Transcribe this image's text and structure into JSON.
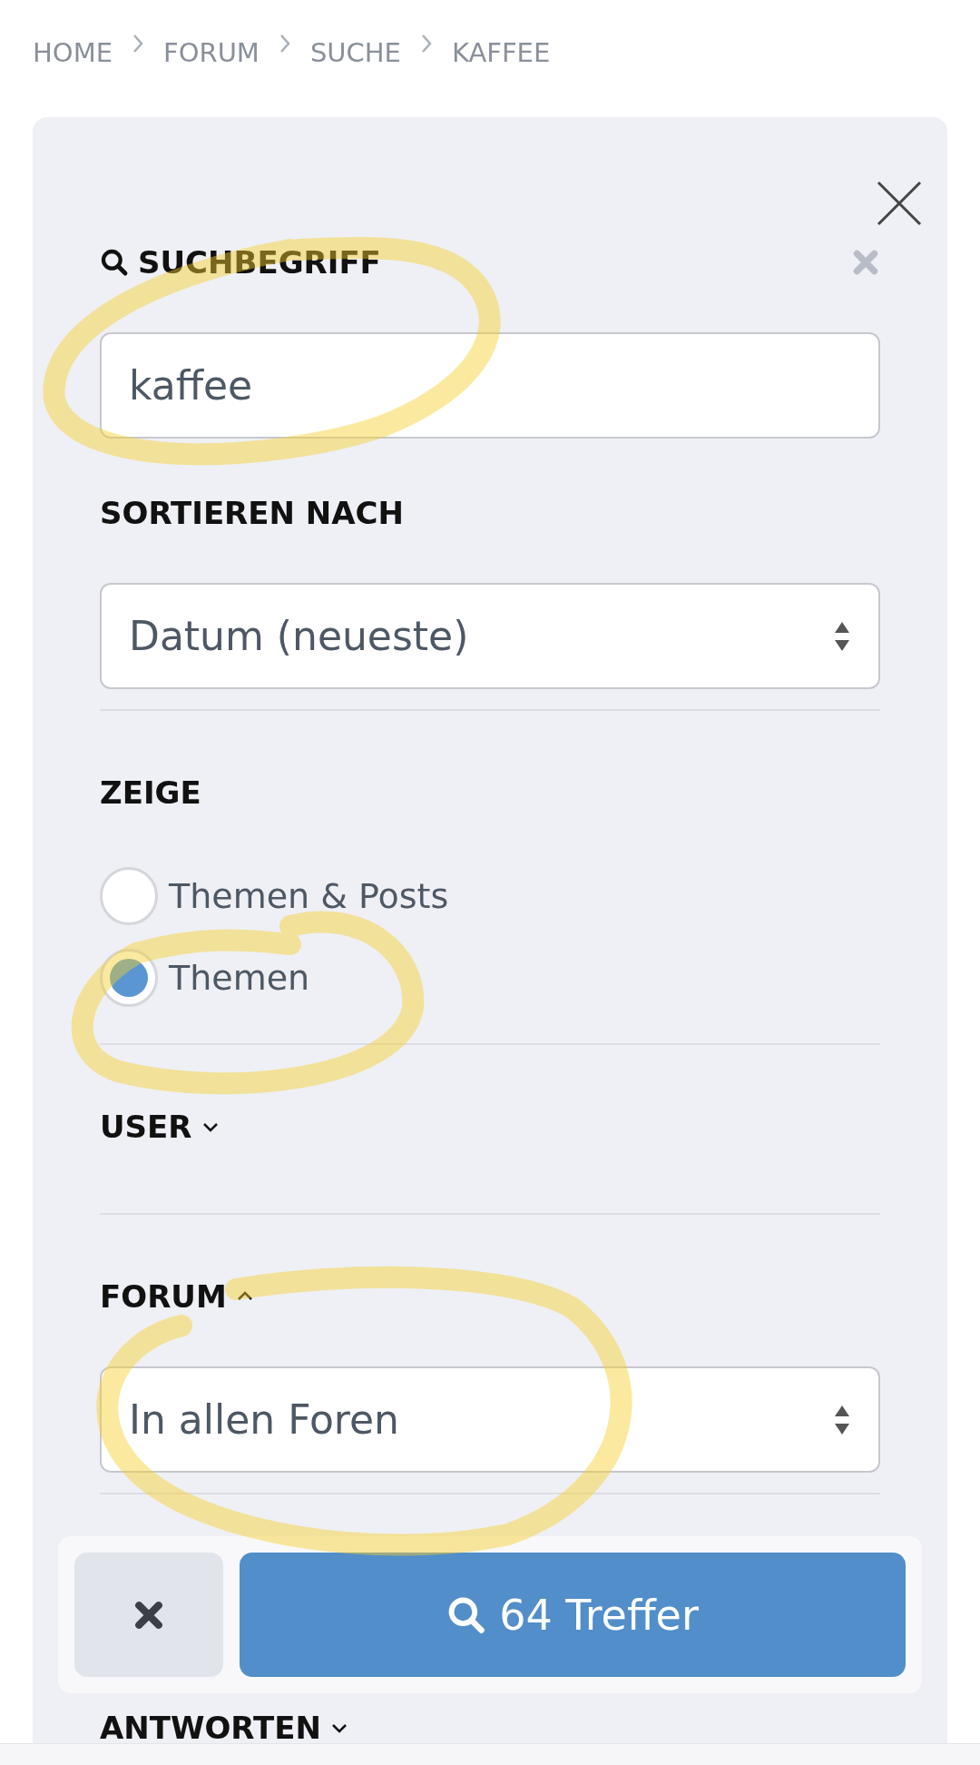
{
  "breadcrumb": [
    "HOME",
    "FORUM",
    "SUCHE",
    "KAFFEE"
  ],
  "sections": [
    {
      "kind": "text",
      "label": "SUCHBEGRIFF",
      "value": "kaffee"
    },
    {
      "kind": "select",
      "label": "SORTIEREN NACH",
      "value": "Datum (neueste)"
    },
    {
      "kind": "radio",
      "label": "ZEIGE",
      "options": [
        {
          "label": "Themen & Posts",
          "selected": false
        },
        {
          "label": "Themen",
          "selected": true
        }
      ]
    },
    {
      "kind": "collapsible",
      "label": "USER",
      "expanded": false
    },
    {
      "kind": "collapsible",
      "label": "FORUM",
      "expanded": true,
      "value": "In allen Foren"
    }
  ],
  "actions": {
    "submit": "64 Treffer"
  },
  "next_section": {
    "label": "ANTWORTEN",
    "expanded": false
  }
}
